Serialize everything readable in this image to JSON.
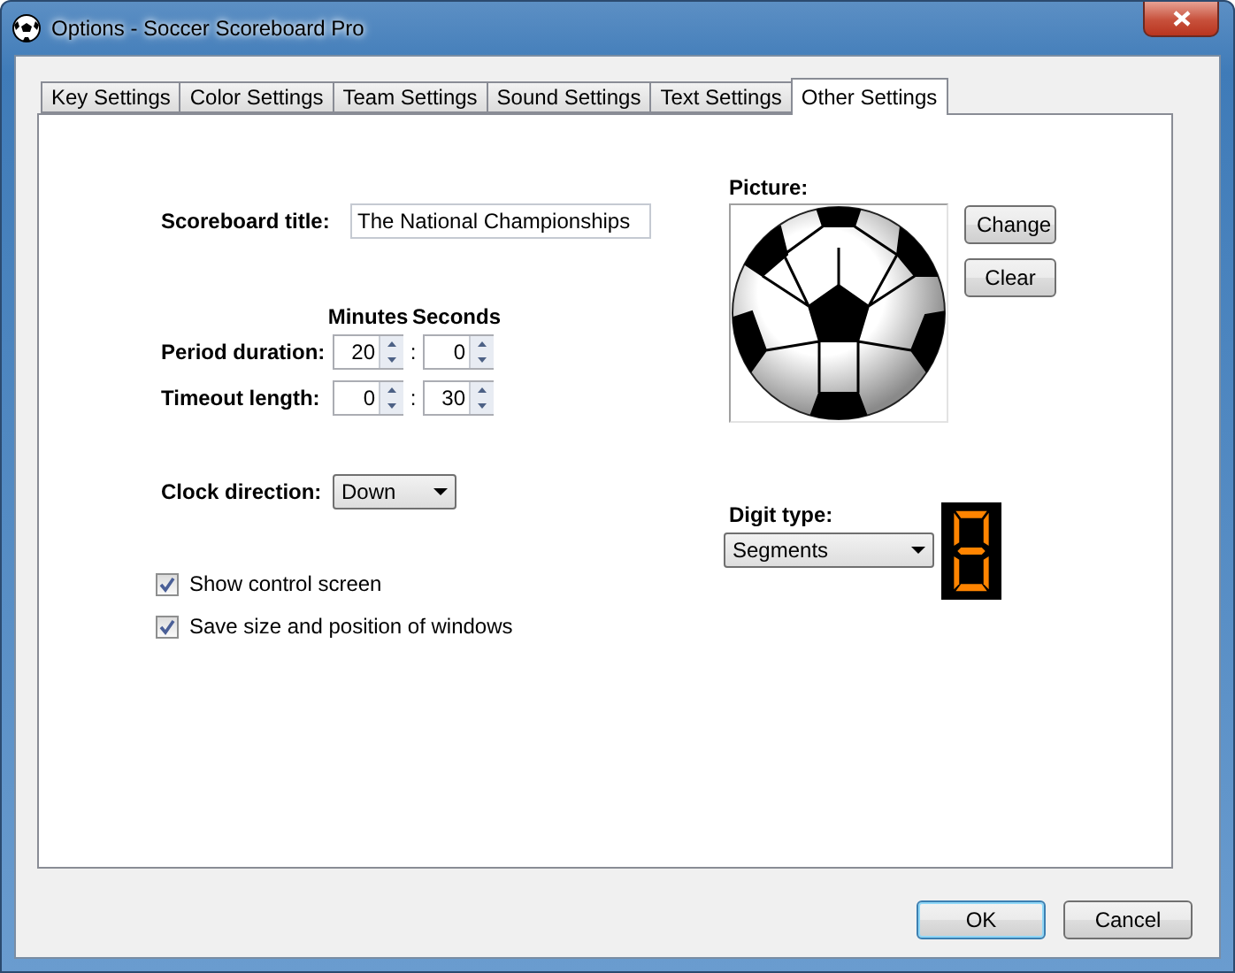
{
  "window": {
    "title": "Options - Soccer Scoreboard Pro"
  },
  "tabs": [
    {
      "label": "Key Settings",
      "selected": false
    },
    {
      "label": "Color Settings",
      "selected": false
    },
    {
      "label": "Team Settings",
      "selected": false
    },
    {
      "label": "Sound Settings",
      "selected": false
    },
    {
      "label": "Text Settings",
      "selected": false
    },
    {
      "label": "Other Settings",
      "selected": true
    }
  ],
  "scoreboard_title": {
    "label": "Scoreboard title:",
    "value": "The National Championships"
  },
  "time": {
    "headers": [
      "Minutes",
      "Seconds"
    ],
    "rows": [
      {
        "label": "Period duration:",
        "minutes": "20",
        "separator": ":",
        "seconds": "0"
      },
      {
        "label": "Timeout length:",
        "minutes": "0",
        "separator": ":",
        "seconds": "30"
      }
    ]
  },
  "clock_direction": {
    "label": "Clock direction:",
    "value": "Down"
  },
  "checkboxes": [
    {
      "label": "Show control screen",
      "checked": true
    },
    {
      "label": "Save size and position of windows",
      "checked": true
    }
  ],
  "picture": {
    "label": "Picture:",
    "buttons": [
      "Change",
      "Clear"
    ]
  },
  "digit_type": {
    "label": "Digit type:",
    "value": "Segments"
  },
  "buttons": [
    {
      "label": "OK",
      "default": true
    },
    {
      "label": "Cancel",
      "default": false
    }
  ]
}
